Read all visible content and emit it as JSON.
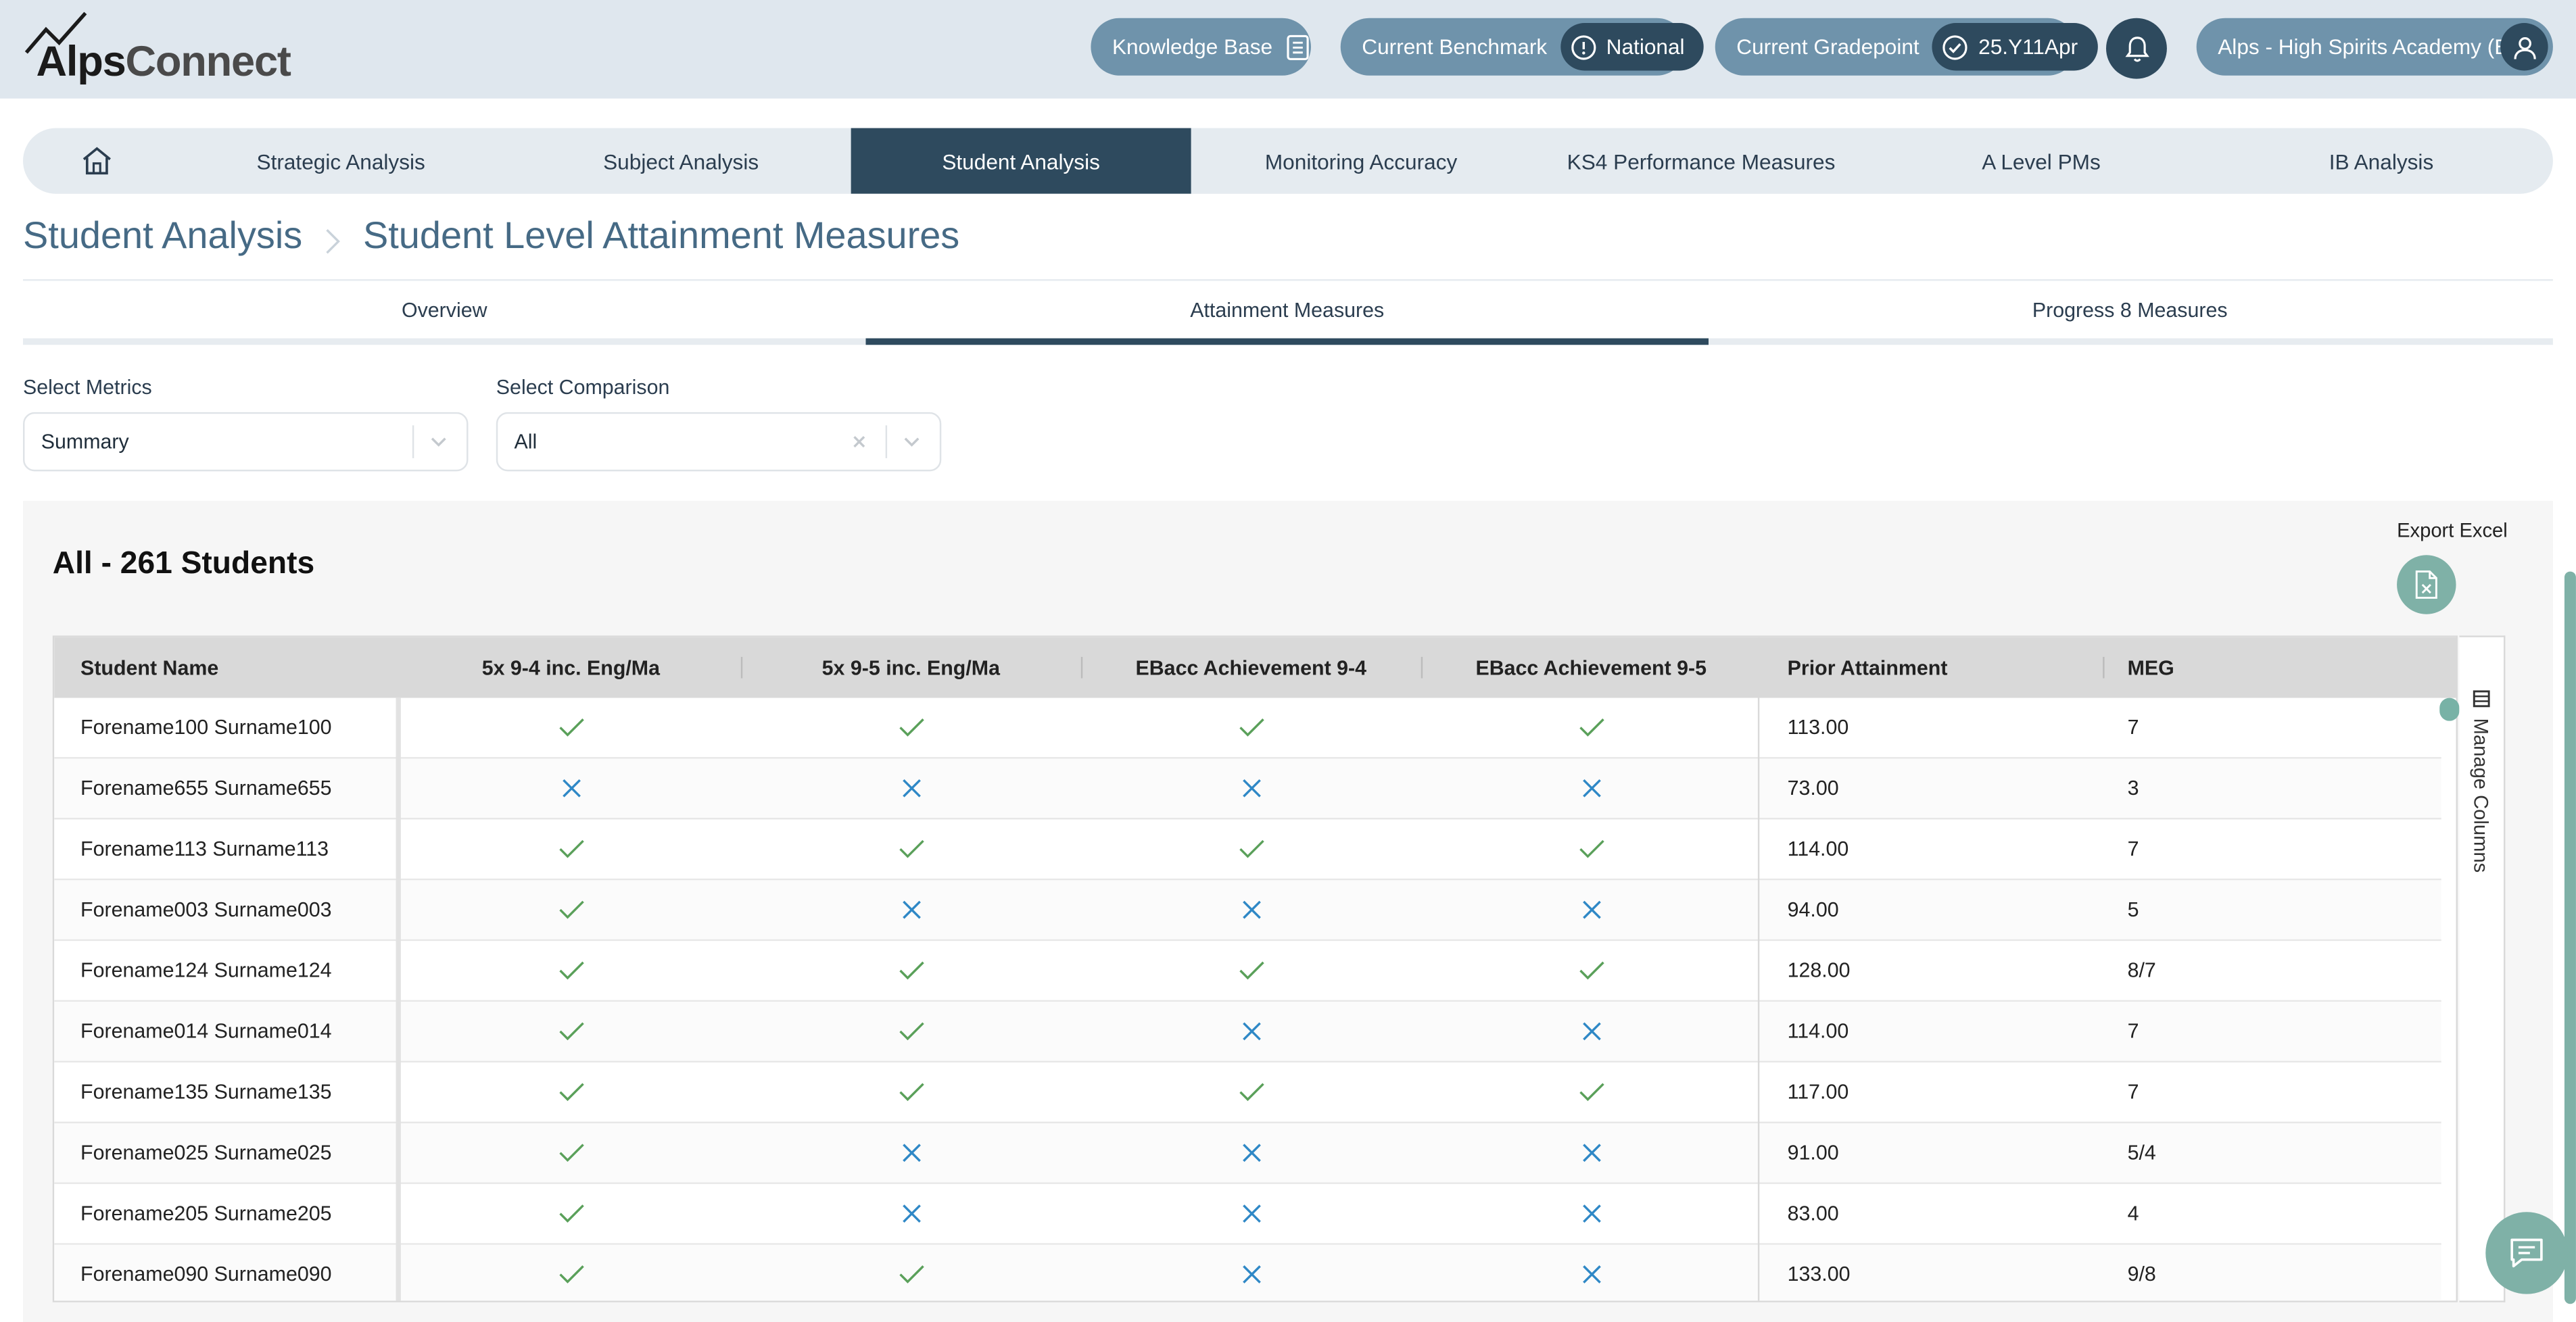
{
  "logo": {
    "part1": "Alps",
    "part2": "Connect"
  },
  "header": {
    "knowledge_base": "Knowledge Base",
    "benchmark_label": "Current Benchmark",
    "benchmark_value": "National",
    "gradepoint_label": "Current Gradepoint",
    "gradepoint_value": "25.Y11Apr",
    "school": "Alps - High Spirits Academy (E)"
  },
  "nav": {
    "tabs": [
      "Strategic Analysis",
      "Subject Analysis",
      "Student Analysis",
      "Monitoring Accuracy",
      "KS4 Performance Measures",
      "A Level PMs",
      "IB Analysis"
    ],
    "active": "Student Analysis"
  },
  "breadcrumb": {
    "parent": "Student Analysis",
    "current": "Student Level Attainment Measures"
  },
  "subtabs": [
    "Overview",
    "Attainment Measures",
    "Progress 8 Measures"
  ],
  "filters": {
    "metrics_label": "Select Metrics",
    "metrics_value": "Summary",
    "comparison_label": "Select Comparison",
    "comparison_value": "All"
  },
  "panel": {
    "title": "All - 261 Students",
    "export_label": "Export Excel",
    "manage_columns": "Manage Columns"
  },
  "table": {
    "headers": [
      "Student Name",
      "5x 9-4 inc. Eng/Ma",
      "5x 9-5 inc. Eng/Ma",
      "EBacc Achievement 9-4",
      "EBacc Achievement 9-5",
      "Prior Attainment",
      "MEG"
    ],
    "rows": [
      {
        "name": "Forename100 Surname100",
        "m1": true,
        "m2": true,
        "m3": true,
        "m4": true,
        "prior": "113.00",
        "meg": "7"
      },
      {
        "name": "Forename655 Surname655",
        "m1": false,
        "m2": false,
        "m3": false,
        "m4": false,
        "prior": "73.00",
        "meg": "3"
      },
      {
        "name": "Forename113 Surname113",
        "m1": true,
        "m2": true,
        "m3": true,
        "m4": true,
        "prior": "114.00",
        "meg": "7"
      },
      {
        "name": "Forename003 Surname003",
        "m1": true,
        "m2": false,
        "m3": false,
        "m4": false,
        "prior": "94.00",
        "meg": "5"
      },
      {
        "name": "Forename124 Surname124",
        "m1": true,
        "m2": true,
        "m3": true,
        "m4": true,
        "prior": "128.00",
        "meg": "8/7"
      },
      {
        "name": "Forename014 Surname014",
        "m1": true,
        "m2": true,
        "m3": false,
        "m4": false,
        "prior": "114.00",
        "meg": "7"
      },
      {
        "name": "Forename135 Surname135",
        "m1": true,
        "m2": true,
        "m3": true,
        "m4": true,
        "prior": "117.00",
        "meg": "7"
      },
      {
        "name": "Forename025 Surname025",
        "m1": true,
        "m2": false,
        "m3": false,
        "m4": false,
        "prior": "91.00",
        "meg": "5/4"
      },
      {
        "name": "Forename205 Surname205",
        "m1": true,
        "m2": false,
        "m3": false,
        "m4": false,
        "prior": "83.00",
        "meg": "4"
      },
      {
        "name": "Forename090 Surname090",
        "m1": true,
        "m2": true,
        "m3": false,
        "m4": false,
        "prior": "133.00",
        "meg": "9/8"
      }
    ]
  },
  "colors": {
    "navy": "#2e4a5e",
    "pill": "#6f93ab",
    "teal": "#7fb1a7",
    "check": "#5aa05a",
    "cross": "#2f88c6"
  }
}
